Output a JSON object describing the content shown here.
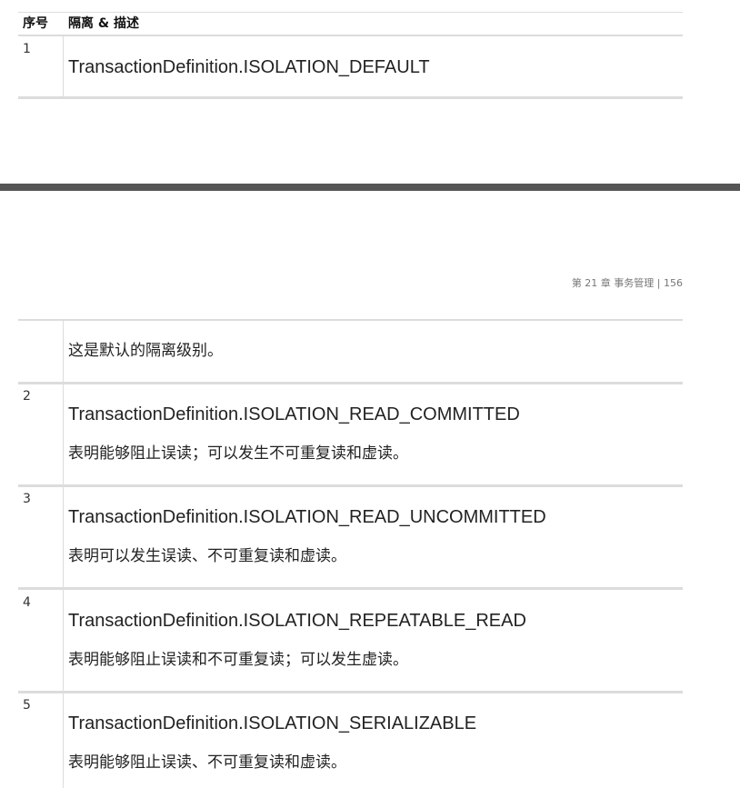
{
  "table_header": {
    "col_num": "序号",
    "col_desc": "隔离 & 描述"
  },
  "rows_page1": [
    {
      "num": "1",
      "constant": "TransactionDefinition.ISOLATION_DEFAULT"
    }
  ],
  "page_header": "第 21 章 事务管理 | 156",
  "rows_page2": [
    {
      "num": "",
      "desc": "这是默认的隔离级别。"
    },
    {
      "num": "2",
      "constant": "TransactionDefinition.ISOLATION_READ_COMMITTED",
      "desc": "表明能够阻止误读；可以发生不可重复读和虚读。"
    },
    {
      "num": "3",
      "constant": "TransactionDefinition.ISOLATION_READ_UNCOMMITTED",
      "desc": "表明可以发生误读、不可重复读和虚读。"
    },
    {
      "num": "4",
      "constant": "TransactionDefinition.ISOLATION_REPEATABLE_READ",
      "desc": "表明能够阻止误读和不可重复读；可以发生虚读。"
    },
    {
      "num": "5",
      "constant": "TransactionDefinition.ISOLATION_SERIALIZABLE",
      "desc": "表明能够阻止误读、不可重复读和虚读。"
    }
  ]
}
